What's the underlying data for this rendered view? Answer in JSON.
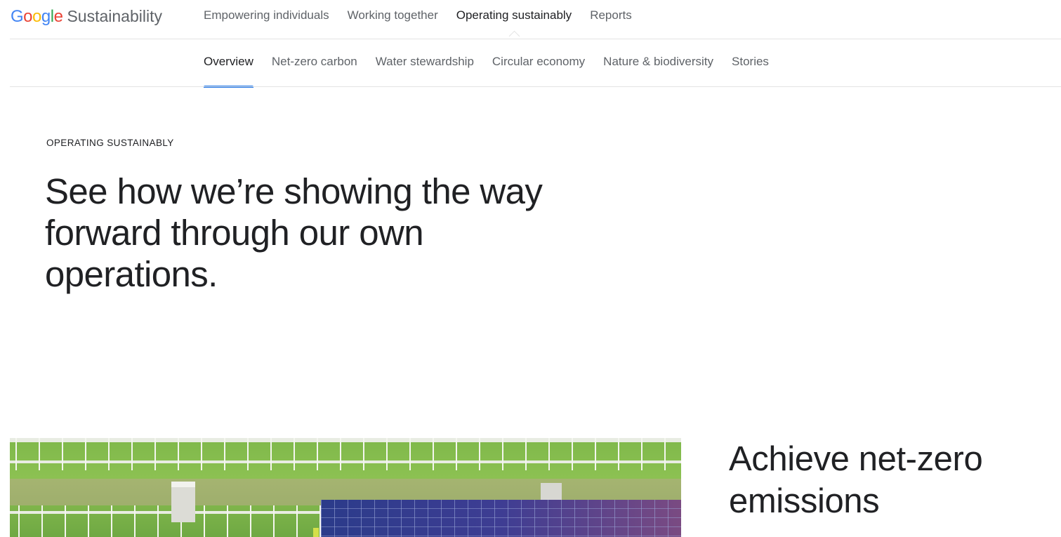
{
  "brand": {
    "logo_letters": [
      {
        "char": "G",
        "color": "#4285F4"
      },
      {
        "char": "o",
        "color": "#EA4335"
      },
      {
        "char": "o",
        "color": "#FBBC05"
      },
      {
        "char": "g",
        "color": "#4285F4"
      },
      {
        "char": "l",
        "color": "#34A853"
      },
      {
        "char": "e",
        "color": "#EA4335"
      }
    ],
    "product": "Sustainability"
  },
  "primary_nav": [
    {
      "label": "Empowering individuals",
      "active": false
    },
    {
      "label": "Working together",
      "active": false
    },
    {
      "label": "Operating sustainably",
      "active": true
    },
    {
      "label": "Reports",
      "active": false
    }
  ],
  "sub_nav": [
    {
      "label": "Overview",
      "active": true
    },
    {
      "label": "Net-zero carbon",
      "active": false
    },
    {
      "label": "Water stewardship",
      "active": false
    },
    {
      "label": "Circular economy",
      "active": false
    },
    {
      "label": "Nature & biodiversity",
      "active": false
    },
    {
      "label": "Stories",
      "active": false
    }
  ],
  "hero": {
    "eyebrow": "OPERATING SUSTAINABLY",
    "title": "See how we’re showing the way forward through our own operations."
  },
  "feature": {
    "title": "Achieve net-zero emissions",
    "image_icon": "solar-panel-field-photo"
  },
  "colors": {
    "accent": "#1a73e8",
    "text": "#202124",
    "muted": "#5f6368",
    "divider": "#e3e3e3"
  }
}
